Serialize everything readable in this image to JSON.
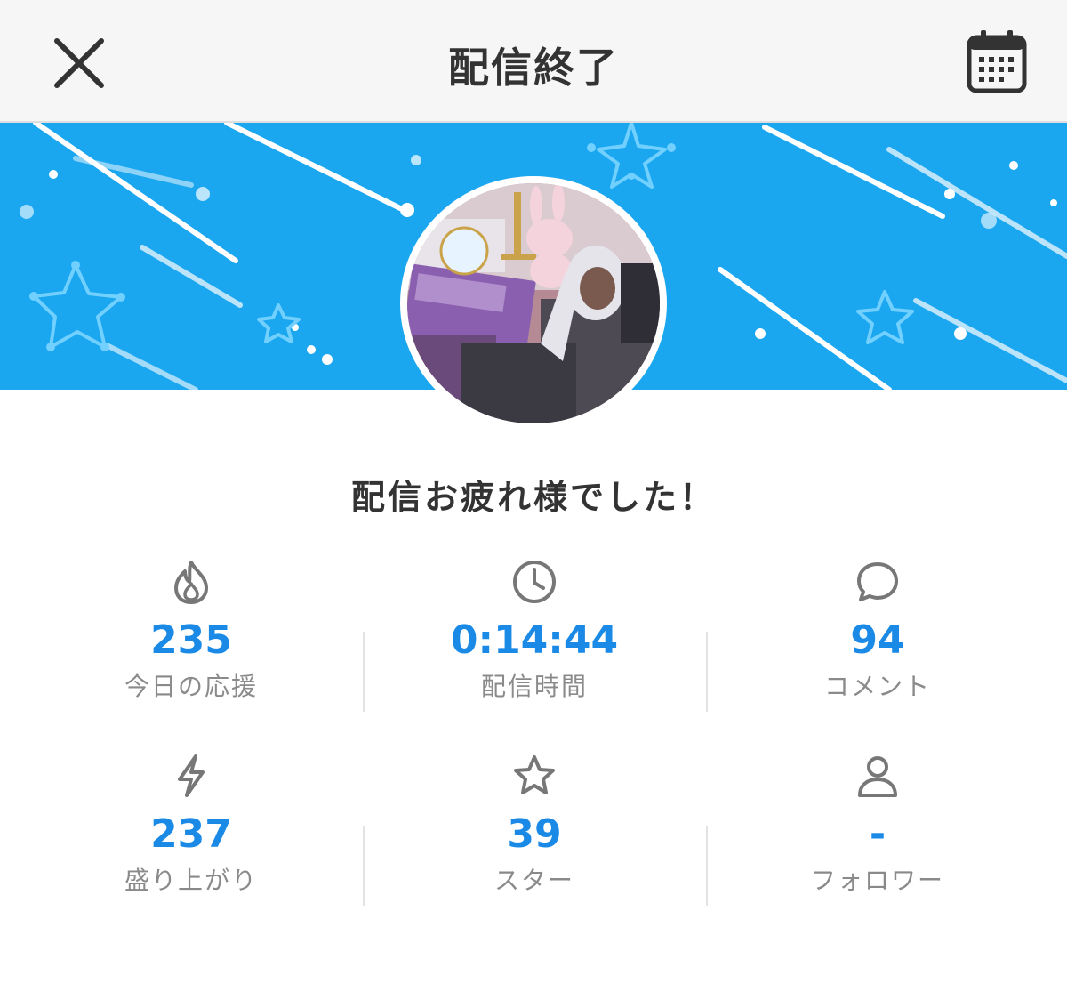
{
  "header": {
    "title": "配信終了",
    "close_icon": "close-icon",
    "calendar_icon": "calendar-icon"
  },
  "message": "配信お疲れ様でした！",
  "colors": {
    "banner": "#1aa7f0",
    "value": "#1a8ae6",
    "label": "#8a8a8a",
    "icon": "#777777",
    "title": "#333333"
  },
  "stats": [
    {
      "icon": "flame-icon",
      "value": "235",
      "label": "今日の応援"
    },
    {
      "icon": "clock-icon",
      "value": "0:14:44",
      "label": "配信時間"
    },
    {
      "icon": "speech-bubble-icon",
      "value": "94",
      "label": "コメント"
    },
    {
      "icon": "lightning-icon",
      "value": "237",
      "label": "盛り上がり"
    },
    {
      "icon": "star-icon",
      "value": "39",
      "label": "スター"
    },
    {
      "icon": "person-icon",
      "value": "-",
      "label": "フォロワー"
    }
  ]
}
